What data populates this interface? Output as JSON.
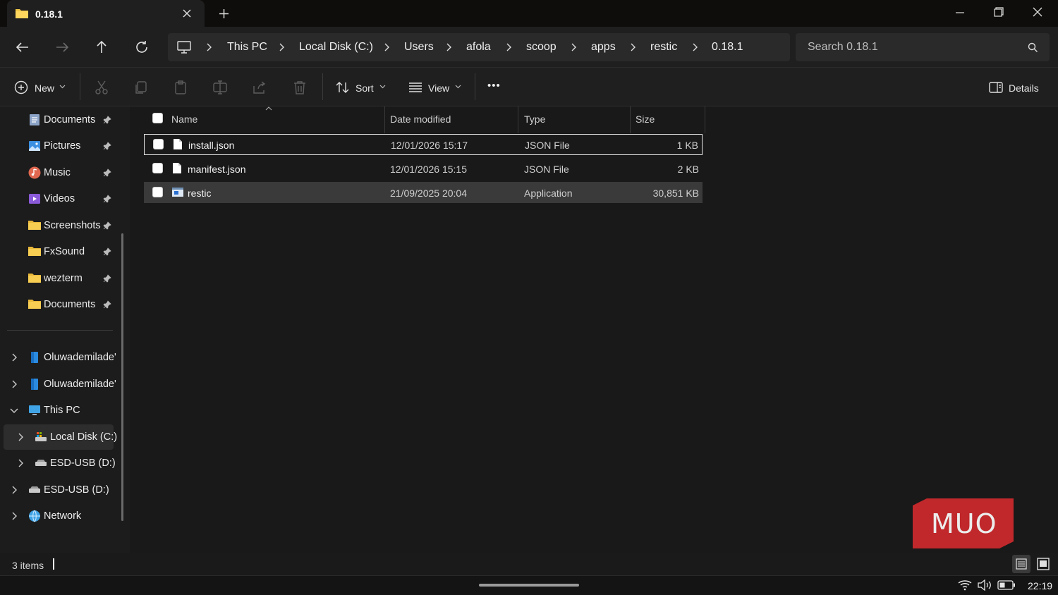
{
  "window": {
    "tab_title": "0.18.1",
    "colors": {
      "accent": "#f2c744",
      "selection": "#3a3a3a",
      "watermark": "#c0282b"
    }
  },
  "address_bar": {
    "breadcrumbs": [
      "This PC",
      "Local Disk (C:)",
      "Users",
      "afola",
      "scoop",
      "apps",
      "restic",
      "0.18.1"
    ],
    "search_placeholder": "Search 0.18.1"
  },
  "toolbar": {
    "new_label": "New",
    "sort_label": "Sort",
    "view_label": "View",
    "more_label": "•••",
    "details_label": "Details"
  },
  "sidebar": {
    "quick_access": [
      {
        "label": "Documents",
        "icon": "documents-icon"
      },
      {
        "label": "Pictures",
        "icon": "pictures-icon"
      },
      {
        "label": "Music",
        "icon": "music-icon"
      },
      {
        "label": "Videos",
        "icon": "videos-icon"
      },
      {
        "label": "Screenshots",
        "icon": "folder-icon"
      },
      {
        "label": "FxSound",
        "icon": "folder-icon"
      },
      {
        "label": "wezterm",
        "icon": "folder-icon"
      },
      {
        "label": "Documents",
        "icon": "folder-icon"
      }
    ],
    "tree": [
      {
        "label": "Oluwademilade'",
        "icon": "onedrive-icon"
      },
      {
        "label": "Oluwademilade'",
        "icon": "onedrive-icon"
      },
      {
        "label": "This PC",
        "icon": "this-pc-icon"
      },
      {
        "label": "Local Disk (C:)",
        "icon": "local-disk-icon"
      },
      {
        "label": "ESD-USB (D:)",
        "icon": "usb-drive-icon"
      },
      {
        "label": "ESD-USB (D:)",
        "icon": "usb-drive-icon"
      },
      {
        "label": "Network",
        "icon": "network-icon"
      }
    ]
  },
  "file_list": {
    "columns": [
      "Name",
      "Date modified",
      "Type",
      "Size"
    ],
    "rows": [
      {
        "name": "install.json",
        "date": "12/01/2026 15:17",
        "type": "JSON File",
        "size": "1 KB"
      },
      {
        "name": "manifest.json",
        "date": "12/01/2026 15:15",
        "type": "JSON File",
        "size": "2 KB"
      },
      {
        "name": "restic",
        "date": "21/09/2025 20:04",
        "type": "Application",
        "size": "30,851 KB"
      }
    ]
  },
  "status_bar": {
    "item_count": "3 items"
  },
  "taskbar": {
    "time": "22:19"
  },
  "watermark": {
    "text": "MUO"
  }
}
